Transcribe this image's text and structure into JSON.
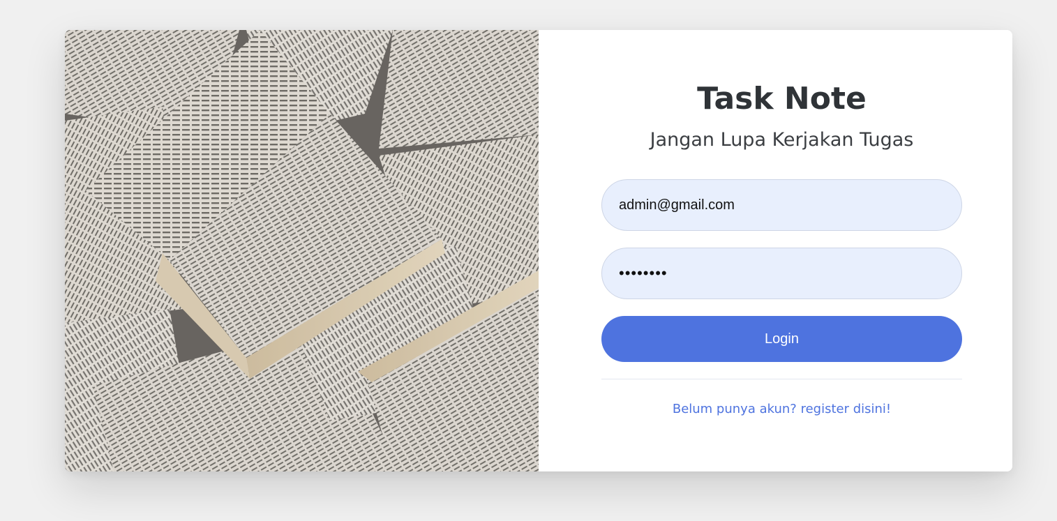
{
  "app": {
    "title": "Task Note",
    "subtitle": "Jangan Lupa Kerjakan Tugas"
  },
  "form": {
    "email_value": "admin@gmail.com",
    "password_value": "••••••••",
    "login_label": "Login",
    "register_link": "Belum punya akun? register disini!"
  },
  "illustration": {
    "subject": "open-books-photo"
  },
  "colors": {
    "page_bg": "#f0f0f0",
    "card_bg": "#ffffff",
    "input_bg": "#e8effd",
    "accent": "#4e73df",
    "title_text": "#2f3337"
  }
}
